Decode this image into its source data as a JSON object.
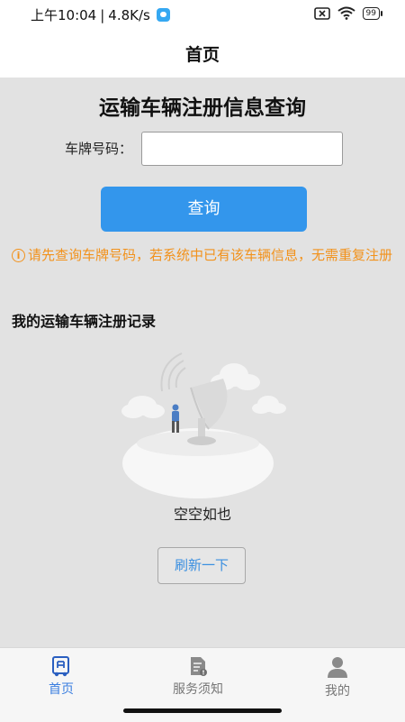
{
  "status_bar": {
    "time": "上午10:04",
    "separator": "|",
    "speed": "4.8K/s",
    "battery": "99",
    "icons": [
      "chat-app-icon",
      "sim-off-icon",
      "wifi-icon",
      "battery-icon"
    ]
  },
  "nav": {
    "title": "首页"
  },
  "form": {
    "heading": "运输车辆注册信息查询",
    "plate_label": "车牌号码：",
    "plate_value": "",
    "plate_placeholder": "",
    "query_button": "查询",
    "notice_icon": "info-icon",
    "notice": "请先查询车牌号码，若系统中已有该车辆信息，无需重复注册"
  },
  "records": {
    "title": "我的运输车辆注册记录",
    "empty_text": "空空如也",
    "refresh_button": "刷新一下",
    "illustration": "satellite-dish-empty-illustration"
  },
  "tabs": [
    {
      "label": "首页",
      "icon": "home-icon",
      "active": true
    },
    {
      "label": "服务须知",
      "icon": "document-icon",
      "active": false
    },
    {
      "label": "我的",
      "icon": "user-icon",
      "active": false
    }
  ],
  "colors": {
    "primary": "#3396ec",
    "notice": "#f2921c",
    "content_bg": "#e2e2e2",
    "tab_active": "#3a7ee0",
    "tab_inactive": "#777777"
  }
}
